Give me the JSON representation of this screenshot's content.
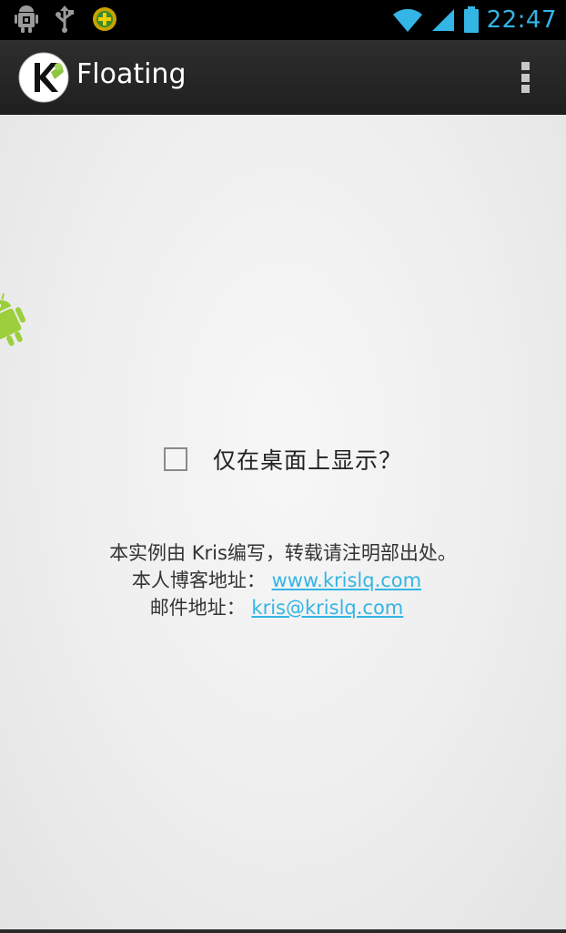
{
  "status_bar": {
    "time": "22:47",
    "time_color": "#33b5e5",
    "left_icons": [
      "android-debug-icon",
      "usb-icon",
      "app-notification-icon"
    ],
    "right_icons": [
      "wifi-icon",
      "signal-icon",
      "battery-icon"
    ]
  },
  "action_bar": {
    "title": "Floating",
    "logo_icon": "kris-logo-icon",
    "overflow_icon": "overflow-menu-icon"
  },
  "main": {
    "checkbox": {
      "label": "仅在桌面上显示？",
      "checked": false
    },
    "info": {
      "line1": "本实例由 Kris编写，转载请注明部出处。",
      "blog_label": "本人博客地址：",
      "blog_link": "www.krislq.com",
      "email_label": "邮件地址：",
      "email_link": "kris@krislq.com"
    },
    "floating_icon": "android-robot-icon"
  }
}
